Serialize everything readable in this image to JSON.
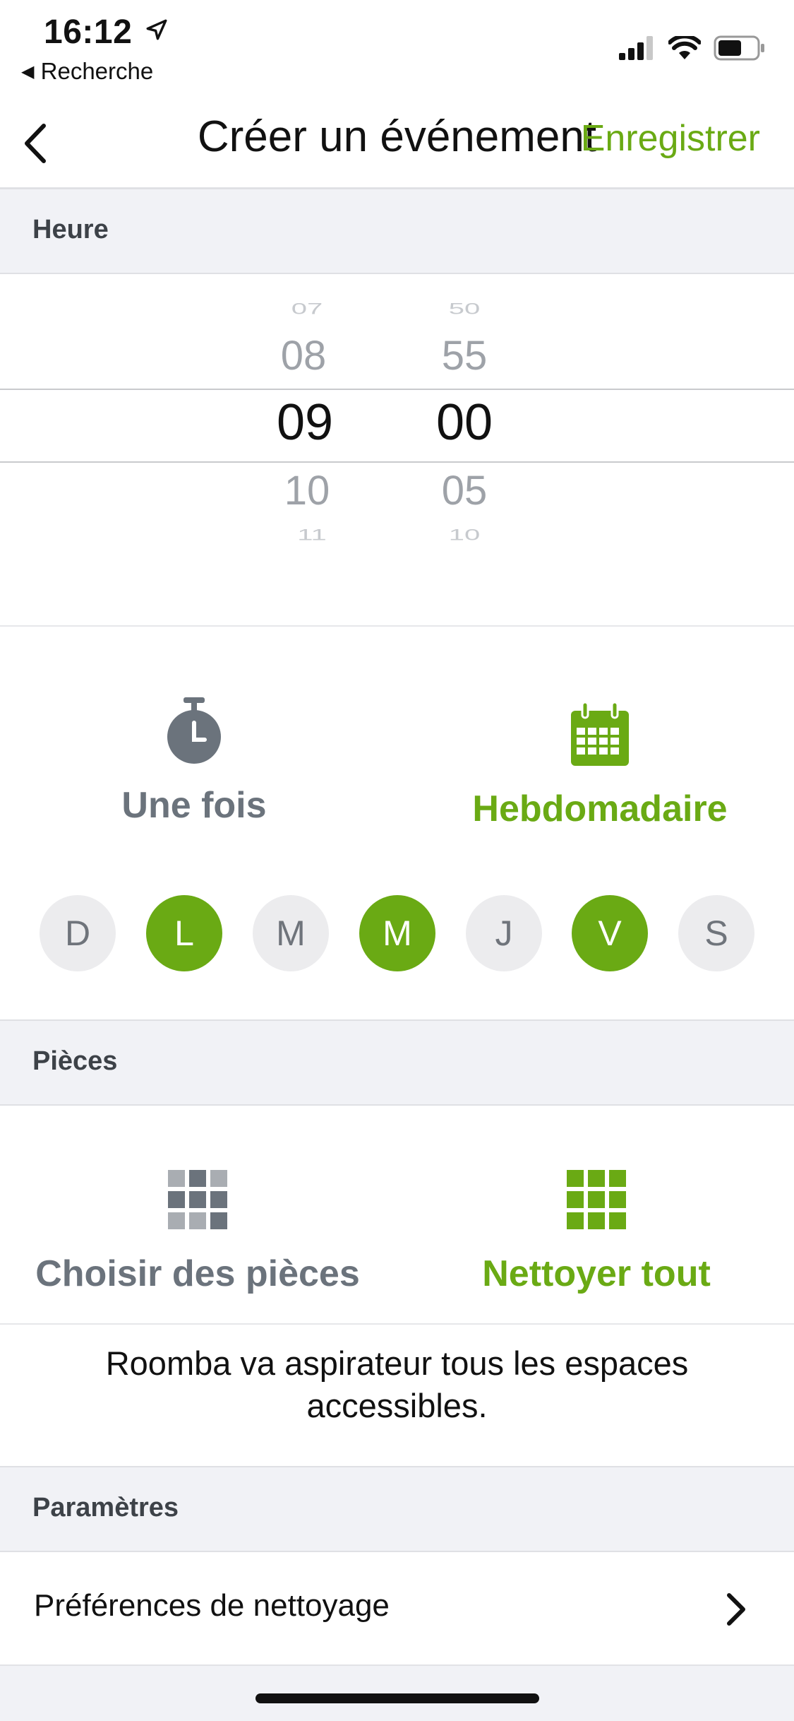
{
  "status": {
    "time": "16:12",
    "back_app": "Recherche"
  },
  "nav": {
    "title": "Créer un événement",
    "save_label": "Enregistrer"
  },
  "sections": {
    "time": "Heure",
    "rooms": "Pièces",
    "settings": "Paramètres"
  },
  "time_picker": {
    "hours": {
      "far_prev": "07",
      "prev": "08",
      "selected": "09",
      "next": "10",
      "far_next": "11"
    },
    "minutes": {
      "far_prev": "50",
      "prev": "55",
      "selected": "00",
      "next": "05",
      "far_next": "10"
    }
  },
  "frequency": {
    "once_label": "Une fois",
    "weekly_label": "Hebdomadaire",
    "selected": "weekly"
  },
  "days": [
    {
      "label": "D",
      "selected": false
    },
    {
      "label": "L",
      "selected": true
    },
    {
      "label": "M",
      "selected": false
    },
    {
      "label": "M",
      "selected": true
    },
    {
      "label": "J",
      "selected": false
    },
    {
      "label": "V",
      "selected": true
    },
    {
      "label": "S",
      "selected": false
    }
  ],
  "rooms": {
    "choose_label": "Choisir des pièces",
    "clean_all_label": "Nettoyer tout",
    "selected": "clean_all",
    "info_line1": "Roomba va aspirateur tous les espaces",
    "info_line2": "accessibles."
  },
  "settings": {
    "cleaning_prefs_label": "Préférences de nettoyage"
  },
  "colors": {
    "accent": "#6aaa14",
    "inactive": "#6b737c",
    "section_bg": "#f1f2f6"
  },
  "icons": {
    "location": "location-arrow-icon",
    "signal": "signal-icon",
    "wifi": "wifi-icon",
    "battery": "battery-icon",
    "back": "chevron-left-icon",
    "once": "stopwatch-icon",
    "weekly": "calendar-icon",
    "choose_rooms": "grid-icon",
    "clean_all": "grid-icon",
    "chevron": "chevron-right-icon"
  }
}
